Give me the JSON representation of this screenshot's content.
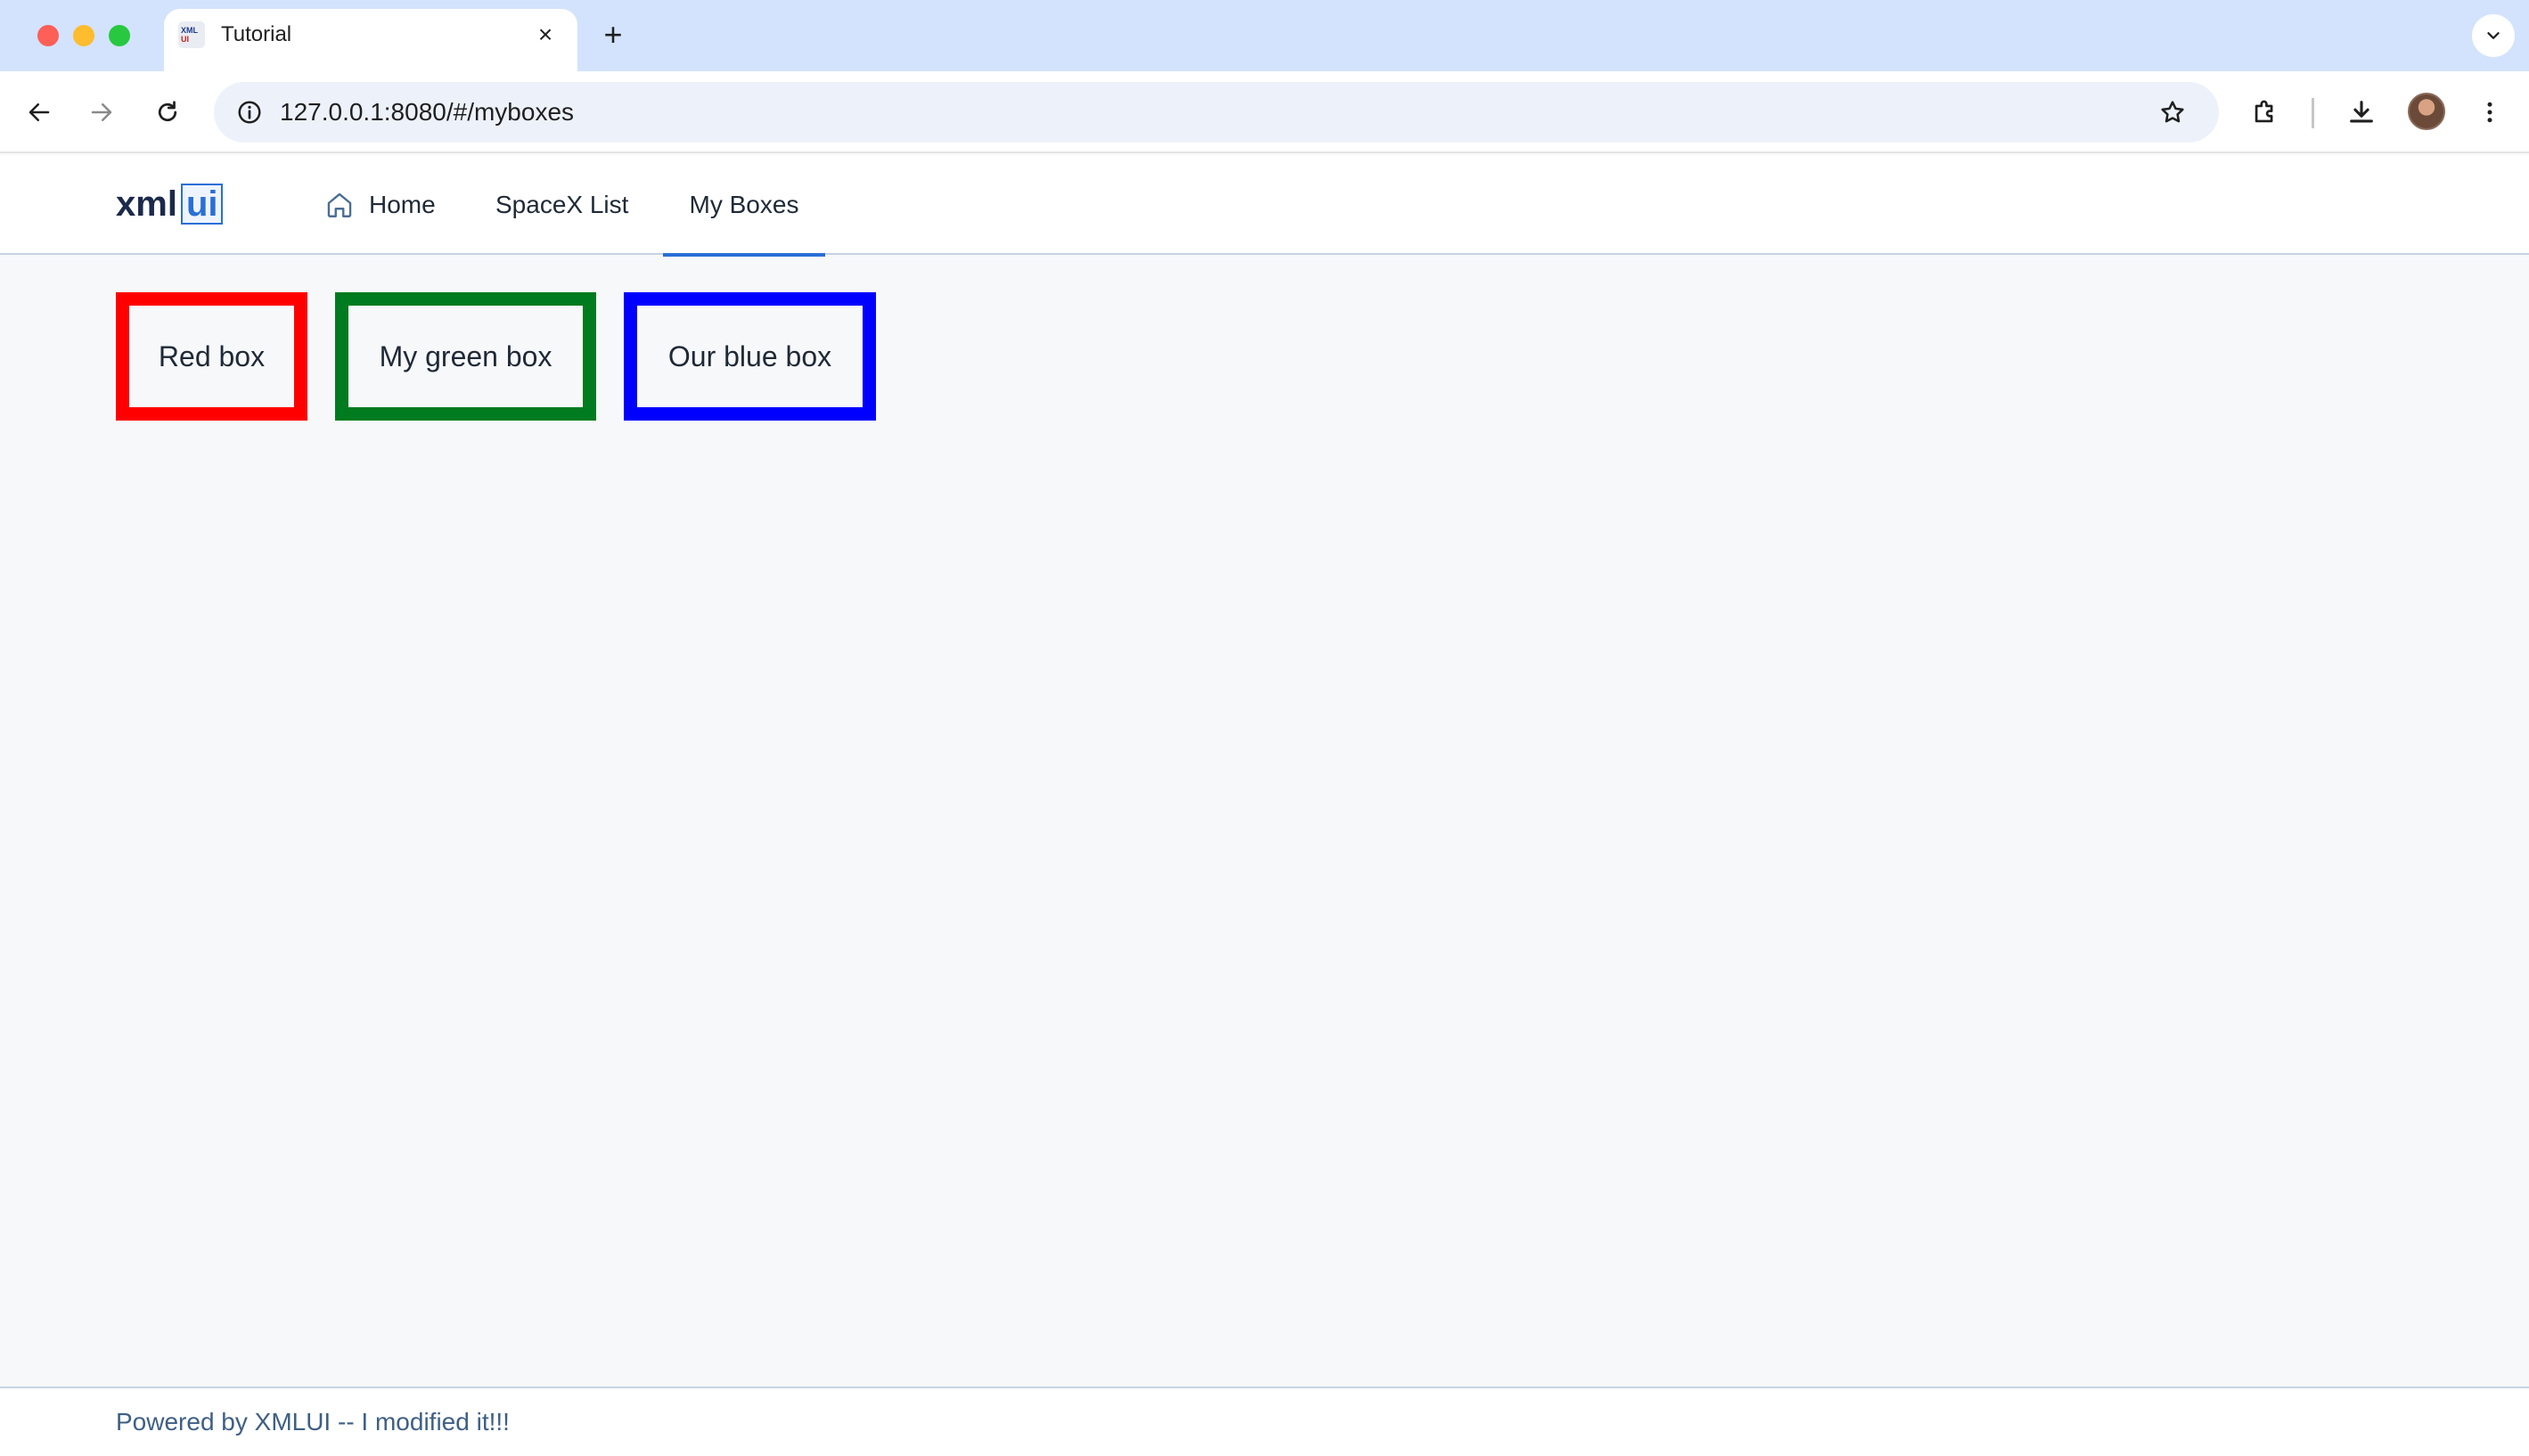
{
  "browser": {
    "tab_title": "Tutorial",
    "favicon_text_top": "XML",
    "favicon_text_bottom": "UI",
    "url": "127.0.0.1:8080/#/myboxes"
  },
  "app": {
    "logo_text": "xml",
    "logo_highlight": "ui",
    "nav": {
      "home": "Home",
      "spacex": "SpaceX List",
      "myboxes": "My Boxes"
    },
    "active_nav": "My Boxes",
    "accent_color": "#2a6fd6"
  },
  "boxes": [
    {
      "label": "Red box",
      "color": "#ff0000"
    },
    {
      "label": "My green box",
      "color": "#007b1f"
    },
    {
      "label": "Our blue box",
      "color": "#0000ff"
    }
  ],
  "footer": {
    "text": "Powered by XMLUI -- I modified it!!!"
  }
}
